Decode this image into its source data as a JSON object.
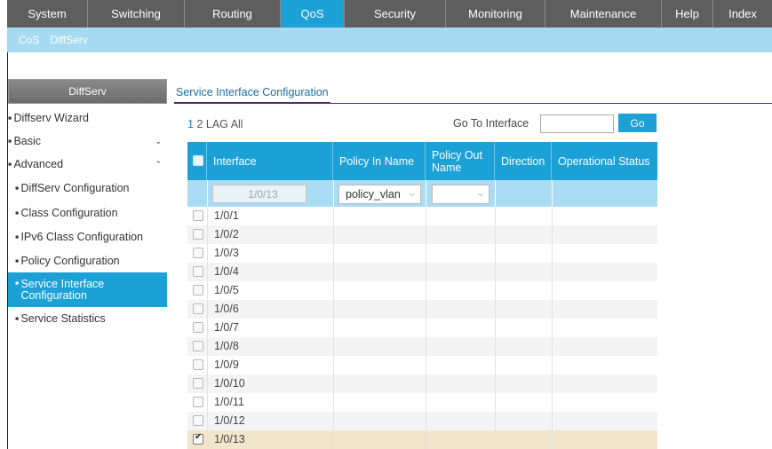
{
  "topnav": {
    "tabs": [
      {
        "label": "System",
        "active": false
      },
      {
        "label": "Switching",
        "active": false
      },
      {
        "label": "Routing",
        "active": false
      },
      {
        "label": "QoS",
        "active": true
      },
      {
        "label": "Security",
        "active": false
      },
      {
        "label": "Monitoring",
        "active": false
      },
      {
        "label": "Maintenance",
        "active": false
      },
      {
        "label": "Help",
        "active": false
      },
      {
        "label": "Index",
        "active": false
      }
    ]
  },
  "subnav": {
    "items": [
      {
        "label": "CoS",
        "active": false
      },
      {
        "label": "DiffServ",
        "active": true
      }
    ]
  },
  "sidebar": {
    "header": "DiffServ",
    "items": [
      {
        "label": "Diffserv Wizard",
        "bullet": "▪",
        "level": 0
      },
      {
        "label": "Basic",
        "bullet": "▪",
        "level": 0,
        "chevron": "⌄"
      },
      {
        "label": "Advanced",
        "bullet": "▪",
        "level": 0,
        "chevron": "⌃"
      },
      {
        "label": "DiffServ Configuration",
        "bullet": "▪",
        "level": 1
      },
      {
        "label": "Class Configuration",
        "bullet": "▪",
        "level": 1
      },
      {
        "label": "IPv6 Class Configuration",
        "bullet": "▪",
        "level": 1
      },
      {
        "label": "Policy Configuration",
        "bullet": "▪",
        "level": 1
      },
      {
        "label": "Service Interface Configuration",
        "bullet": "▪",
        "level": 1,
        "selected": true
      },
      {
        "label": "Service Statistics",
        "bullet": "▪",
        "level": 1
      }
    ]
  },
  "main": {
    "title": "Service Interface Configuration",
    "pager": {
      "p1": "1",
      "p2": "2",
      "lag": "LAG",
      "all": "All"
    },
    "goto_label": "Go To Interface",
    "goto_value": "",
    "go_button": "Go"
  },
  "table": {
    "columns": [
      "Interface",
      "Policy In Name",
      "Policy Out Name",
      "Direction",
      "Operational Status"
    ],
    "filter": {
      "interface": "1/0/13",
      "policy_in": "policy_vlan",
      "policy_out": ""
    },
    "rows": [
      {
        "interface": "1/0/1",
        "checked": false
      },
      {
        "interface": "1/0/2",
        "checked": false
      },
      {
        "interface": "1/0/3",
        "checked": false
      },
      {
        "interface": "1/0/4",
        "checked": false
      },
      {
        "interface": "1/0/5",
        "checked": false
      },
      {
        "interface": "1/0/6",
        "checked": false
      },
      {
        "interface": "1/0/7",
        "checked": false
      },
      {
        "interface": "1/0/8",
        "checked": false
      },
      {
        "interface": "1/0/9",
        "checked": false
      },
      {
        "interface": "1/0/10",
        "checked": false
      },
      {
        "interface": "1/0/11",
        "checked": false
      },
      {
        "interface": "1/0/12",
        "checked": false
      },
      {
        "interface": "1/0/13",
        "checked": true
      }
    ]
  },
  "colors": {
    "accent": "#1ba1d6",
    "nav_bg": "#5e5e5e",
    "subnav_bg": "#a6d9f2",
    "checked_row": "#f1e5cc"
  },
  "icons": {
    "dropdown": "chevron-down-icon",
    "checkbox": "checkbox-icon",
    "bullet": "bullet-icon"
  }
}
